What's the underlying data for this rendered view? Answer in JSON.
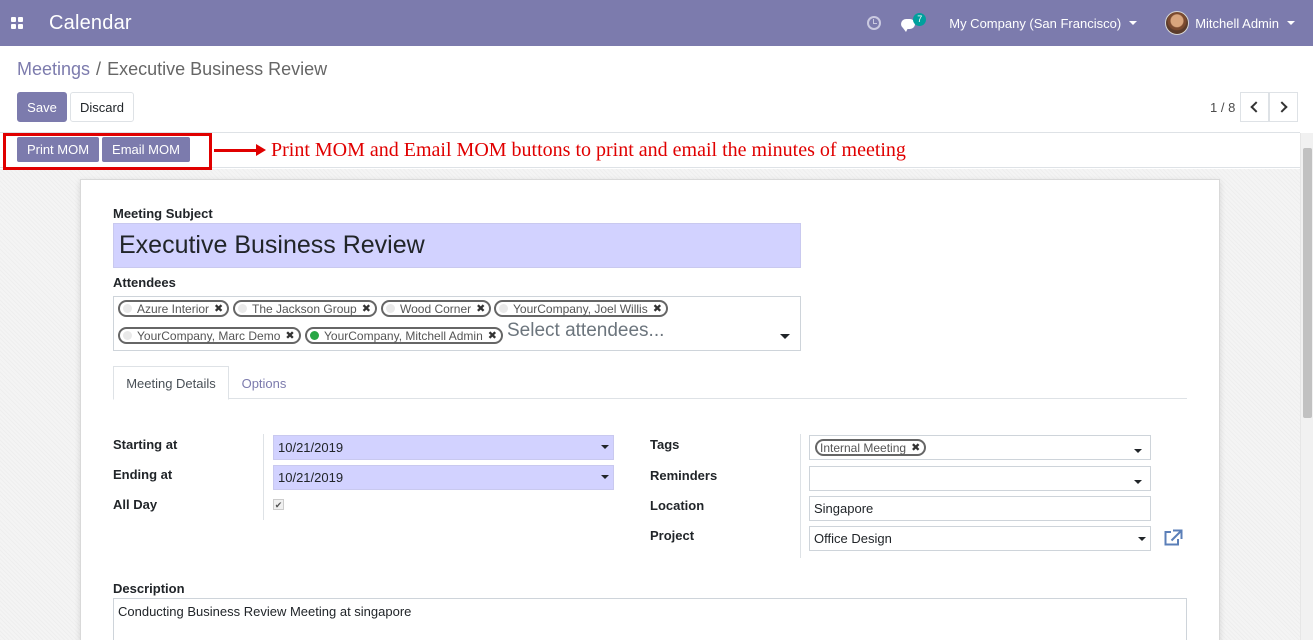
{
  "navbar": {
    "app_title": "Calendar",
    "message_count": "7",
    "company": "My Company (San Francisco)",
    "user_name": "Mitchell Admin",
    "bg_color": "#7c7bad"
  },
  "breadcrumb": {
    "parent": "Meetings",
    "separator": "/",
    "current": "Executive Business Review"
  },
  "actions": {
    "save_label": "Save",
    "discard_label": "Discard"
  },
  "pager": {
    "value": "1 / 8"
  },
  "statusbar": {
    "print_mom_label": "Print MOM",
    "email_mom_label": "Email MOM"
  },
  "annotation": {
    "text": "Print MOM and Email MOM buttons to print and email the minutes of meeting",
    "color": "#e00000"
  },
  "form": {
    "subject_label": "Meeting Subject",
    "subject_value": "Executive Business Review",
    "attendees_label": "Attendees",
    "attendees": [
      {
        "name": "Azure Interior",
        "status": "none"
      },
      {
        "name": "The Jackson Group",
        "status": "none"
      },
      {
        "name": "Wood Corner",
        "status": "none"
      },
      {
        "name": "YourCompany, Joel Willis",
        "status": "none"
      },
      {
        "name": "YourCompany, Marc Demo",
        "status": "none"
      },
      {
        "name": "YourCompany, Mitchell Admin",
        "status": "online"
      }
    ],
    "attendees_placeholder": "Select attendees...",
    "tabs": [
      "Meeting Details",
      "Options"
    ],
    "starting_label": "Starting at",
    "starting_value": "10/21/2019",
    "ending_label": "Ending at",
    "ending_value": "10/21/2019",
    "allday_label": "All Day",
    "allday_checked": true,
    "tags_label": "Tags",
    "tags": [
      "Internal Meeting"
    ],
    "reminders_label": "Reminders",
    "reminders_value": "",
    "location_label": "Location",
    "location_value": "Singapore",
    "project_label": "Project",
    "project_value": "Office Design",
    "description_label": "Description",
    "description_value": "Conducting Business Review Meeting at singapore"
  },
  "icons": [
    "apps-icon",
    "clock-icon",
    "chat-icon",
    "chevron-left-icon",
    "chevron-right-icon",
    "external-link-icon",
    "close-icon",
    "caret-down-icon"
  ]
}
